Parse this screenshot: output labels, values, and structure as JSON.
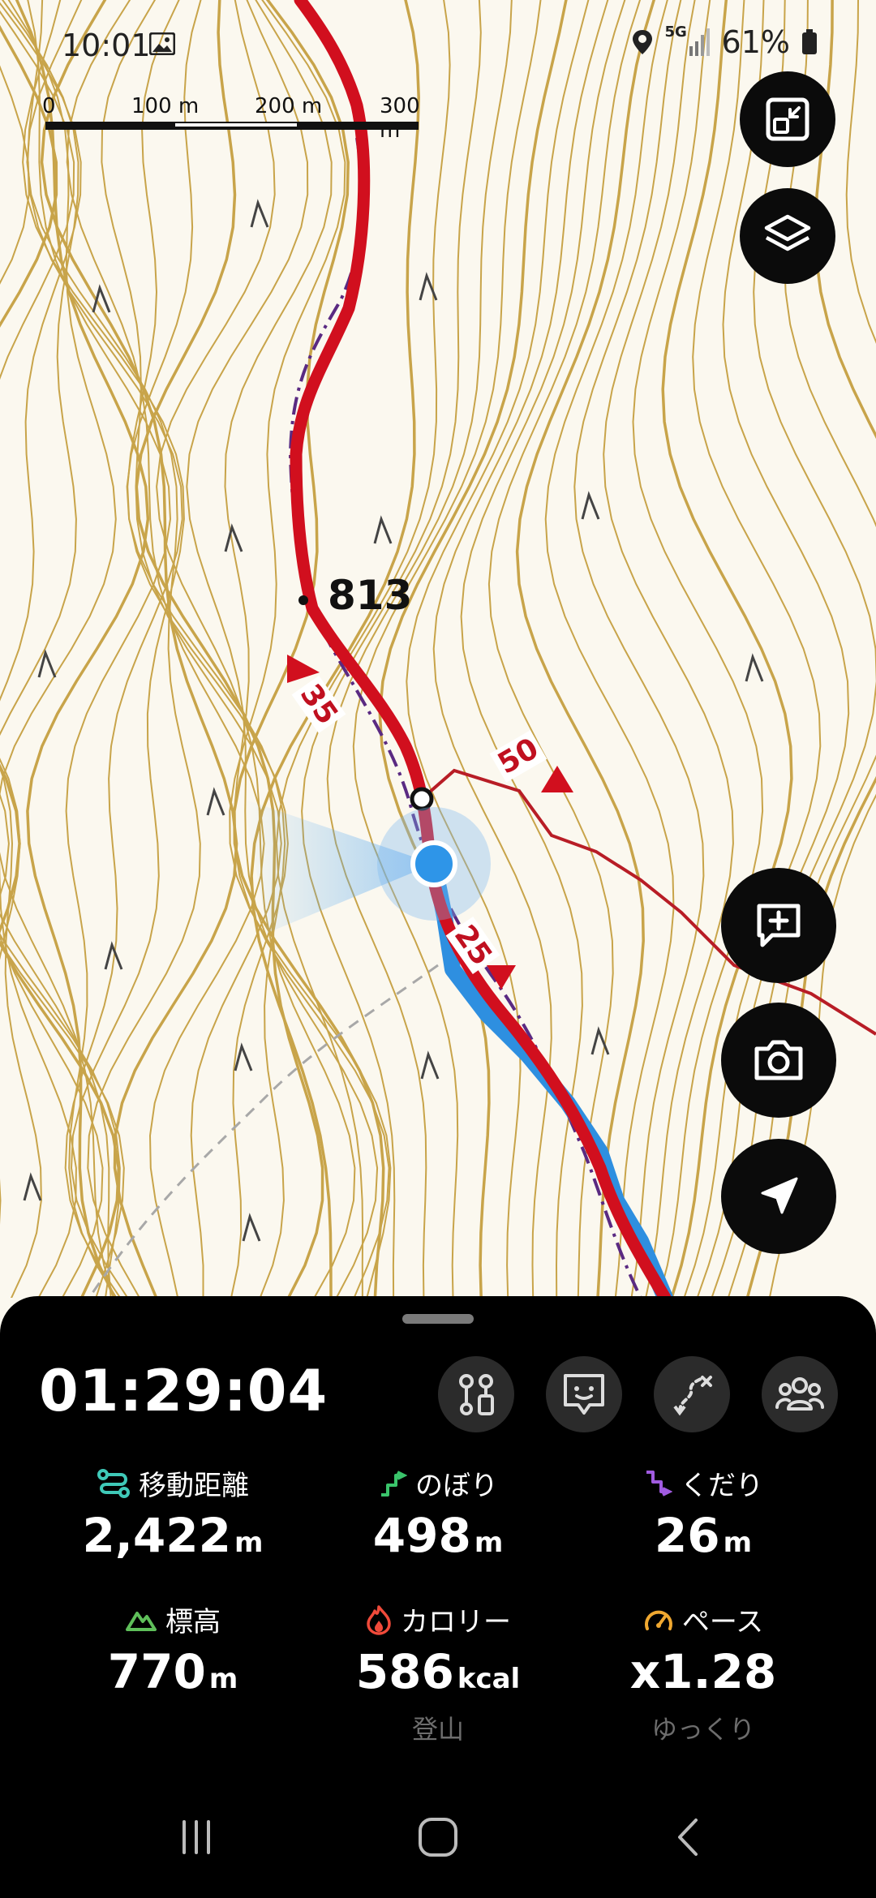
{
  "status_bar": {
    "time": "10:01",
    "network": "5G",
    "battery": "61%"
  },
  "scale_bar": {
    "labels": [
      "0",
      "100 m",
      "200 m",
      "300 m"
    ]
  },
  "map": {
    "elevation_marker": "813",
    "route_markers": [
      "35",
      "50",
      "25"
    ],
    "colors": {
      "contour": "#c8a44a",
      "route_red": "#d10f1e",
      "track_blue": "#2e8fe0",
      "location_dot": "#2e95e8"
    }
  },
  "map_buttons": [
    "map-resize",
    "layers",
    "add-memo",
    "camera",
    "navigation"
  ],
  "panel": {
    "timer": "01:29:04",
    "tools": [
      "waypoints",
      "memo-list",
      "route-off",
      "group"
    ],
    "stats": [
      {
        "label": "移動距離",
        "value": "2,422",
        "unit": "m",
        "sub": "",
        "icon": "route-icon",
        "color": "#3fc9b8"
      },
      {
        "label": "のぼり",
        "value": "498",
        "unit": "m",
        "sub": "",
        "icon": "ascent-icon",
        "color": "#3ac46b"
      },
      {
        "label": "くだり",
        "value": "26",
        "unit": "m",
        "sub": "",
        "icon": "descent-icon",
        "color": "#a05be0"
      },
      {
        "label": "標高",
        "value": "770",
        "unit": "m",
        "sub": "",
        "icon": "mountain-icon",
        "color": "#5fbf5a"
      },
      {
        "label": "カロリー",
        "value": "586",
        "unit": "kcal",
        "sub": "登山",
        "icon": "flame-icon",
        "color": "#f04a3a"
      },
      {
        "label": "ペース",
        "value": "x1.28",
        "unit": "",
        "sub": "ゆっくり",
        "icon": "speedometer-icon",
        "color": "#f0a830"
      }
    ]
  }
}
